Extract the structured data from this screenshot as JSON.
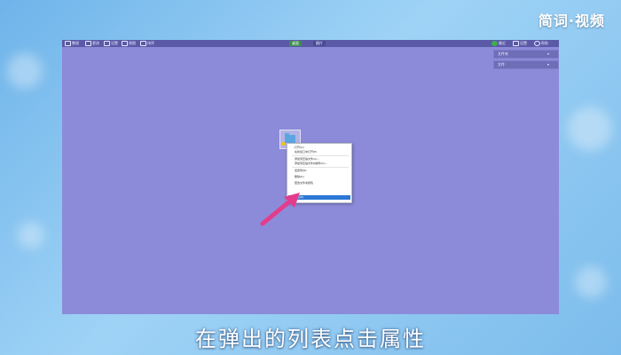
{
  "brand": {
    "text": "简词·视频"
  },
  "taskbar": {
    "left_items": [
      "整理",
      "更改",
      "设置",
      "视图",
      "排序"
    ],
    "center_items": [
      "桌面",
      "图片"
    ],
    "right_items": [
      "最近",
      "设置",
      "帮助"
    ]
  },
  "side_panel": {
    "rows": [
      {
        "label": "文件夹"
      },
      {
        "label": "文件"
      }
    ]
  },
  "context_menu": {
    "items": [
      {
        "label": "打开(O)"
      },
      {
        "label": "在新窗口中打开(E)"
      },
      {
        "label": "添加到压缩文件(A)..."
      },
      {
        "label": "添加到压缩文件并邮件(C)..."
      },
      {
        "label": "发送到(N)"
      },
      {
        "label": "删除(D)"
      },
      {
        "label": "更改文件夹颜色"
      },
      {
        "label": "属性(R)"
      }
    ],
    "selected_index": 7,
    "color_swatches": [
      "#e64a3b",
      "#f08a24",
      "#f2c200",
      "#8bc34a",
      "#2bb24c",
      "#2b78d6",
      "#6a4fc2",
      "#9a9a9a"
    ]
  },
  "colors": {
    "desktop_bg": "#8c8bd9",
    "taskbar_bg": "#5a5aa6",
    "selection": "#2b78d6",
    "arrow": "#e43c8c"
  },
  "caption": {
    "text": "在弹出的列表点击属性"
  }
}
